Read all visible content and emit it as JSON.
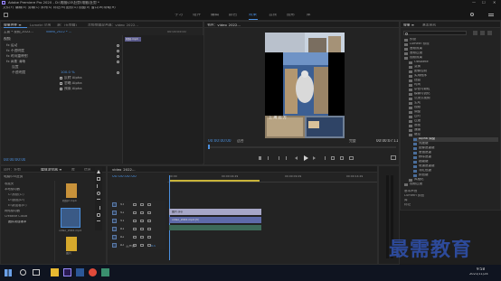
{
  "app": {
    "title": "Adobe Premiere Pro 2020 - D:\\电脑\\03\\狂剪\\电脑\\狂剪 *",
    "menu": [
      "文件(F)",
      "编辑(E)",
      "剪辑(C)",
      "序列(S)",
      "标记(M)",
      "图形(G)",
      "视图(V)",
      "窗口(W)",
      "帮助(H)"
    ],
    "workspaces": [
      "学习",
      "组件",
      "编辑",
      "颜色",
      "效果",
      "音频",
      "图形",
      "库"
    ],
    "active_workspace": "效果",
    "window_controls": [
      "—",
      "☐",
      "✕"
    ]
  },
  "effect_controls": {
    "tabs": [
      "效果控件 ≡",
      "Lumetri 范围",
      "源：(无剪辑)",
      "音频剪辑混合器：video_2022..."
    ],
    "source_label": "主要 * 视频_2022...",
    "sequence_label": "video_2022 * ...",
    "clip_name": "视频.mp4",
    "mini_timecode": "00:00:05:00",
    "section_video": "视频",
    "rows": [
      "fx 运动",
      "fx 不透明度",
      "fx 时间重映射",
      "fx 高斯 清晰"
    ],
    "sub_header": "设置",
    "opacity_label": "不透明度",
    "opacity_value": "100.0 %",
    "checkbox_rows": [
      "反转 Alpha",
      "忽略 Alpha",
      "预乘 Alpha"
    ],
    "timecode": "00:00:00:00"
  },
  "program_monitor": {
    "tab": "节目：video_2022...",
    "timecode_left": "00:00:00:00",
    "fit": "适合",
    "quality": "完整",
    "timecode_right": "00:00:07:11",
    "caption_text": "上 海 远 方"
  },
  "effects_panel": {
    "tabs": [
      "效果 ≡",
      "基本图形"
    ],
    "items": [
      {
        "label": "预设",
        "indent": 0
      },
      {
        "label": "Lumetri 预设",
        "indent": 0
      },
      {
        "label": "音频效果",
        "indent": 0
      },
      {
        "label": "音频过渡",
        "indent": 0
      },
      {
        "label": "视频效果",
        "indent": 0
      },
      {
        "label": "Obsolete",
        "indent": 1
      },
      {
        "label": "变换",
        "indent": 1
      },
      {
        "label": "图像控制",
        "indent": 1
      },
      {
        "label": "实用程序",
        "indent": 1
      },
      {
        "label": "扭曲",
        "indent": 1
      },
      {
        "label": "时间",
        "indent": 1
      },
      {
        "label": "杂色与颗粒",
        "indent": 1
      },
      {
        "label": "模糊与锐化",
        "indent": 1
      },
      {
        "label": "沉浸式视频",
        "indent": 1
      },
      {
        "label": "生成",
        "indent": 1
      },
      {
        "label": "视频",
        "indent": 1
      },
      {
        "label": "调整",
        "indent": 1
      },
      {
        "label": "过时",
        "indent": 1
      },
      {
        "label": "过渡",
        "indent": 1
      },
      {
        "label": "透视",
        "indent": 1
      },
      {
        "label": "通道",
        "indent": 1
      },
      {
        "label": "键控",
        "indent": 1
      },
      {
        "label": "Alpha 调整",
        "indent": 2,
        "selected": true
      },
      {
        "label": "亮度键",
        "indent": 2
      },
      {
        "label": "图像遮罩键",
        "indent": 2
      },
      {
        "label": "差值遮罩",
        "indent": 2
      },
      {
        "label": "移除遮罩",
        "indent": 2
      },
      {
        "label": "超级键",
        "indent": 2
      },
      {
        "label": "轨道遮罩键",
        "indent": 2
      },
      {
        "label": "非红色键",
        "indent": 2
      },
      {
        "label": "颜色键",
        "indent": 2
      },
      {
        "label": "风格化",
        "indent": 1
      },
      {
        "label": "视频过渡",
        "indent": 0
      }
    ],
    "bottom_items": [
      "基本声音",
      "Lumetri 颜色",
      "库",
      "标记",
      "历史记录",
      "信息"
    ]
  },
  "project": {
    "tabs": [
      "项目：狂剪",
      "媒体浏览器 ≡",
      "库",
      "信息"
    ],
    "path": "电脑\\03\\狂剪",
    "tree": [
      "收藏夹",
      "本地驱动器",
      "C:\\系统(C:)",
      "D:\\数据(D:)",
      "E:\\新加卷(E:)",
      "网络驱动器",
      "Creative Cloud",
      "团队项目版本"
    ],
    "thumbs": [
      {
        "label": "视频2.mp4",
        "color": "#c8923a"
      },
      {
        "label": "video_2022.mp4",
        "color": "#3a5a86"
      },
      {
        "label": "图片",
        "color": "#d6a92c"
      },
      {
        "label": "视频素材",
        "color": "#c99a32"
      }
    ]
  },
  "timeline": {
    "tab": "video_2022...",
    "timecode": "00:00:00:00",
    "ruler": [
      "00:00",
      "00:00:04:29",
      "00:00:09:29",
      "00:00:14:29"
    ],
    "tracks": [
      {
        "name": "V3"
      },
      {
        "name": "V2",
        "clip": "图片.jpg"
      },
      {
        "name": "V1",
        "clip": "video_2022.mp4 [V]"
      },
      {
        "name": "A1"
      },
      {
        "name": "A2"
      },
      {
        "name": "A3"
      }
    ],
    "master_label": "主声道",
    "master_value": "0.0"
  },
  "taskbar": {
    "time": "9:58",
    "date": "2021/11/24"
  },
  "watermark": "最需教育"
}
